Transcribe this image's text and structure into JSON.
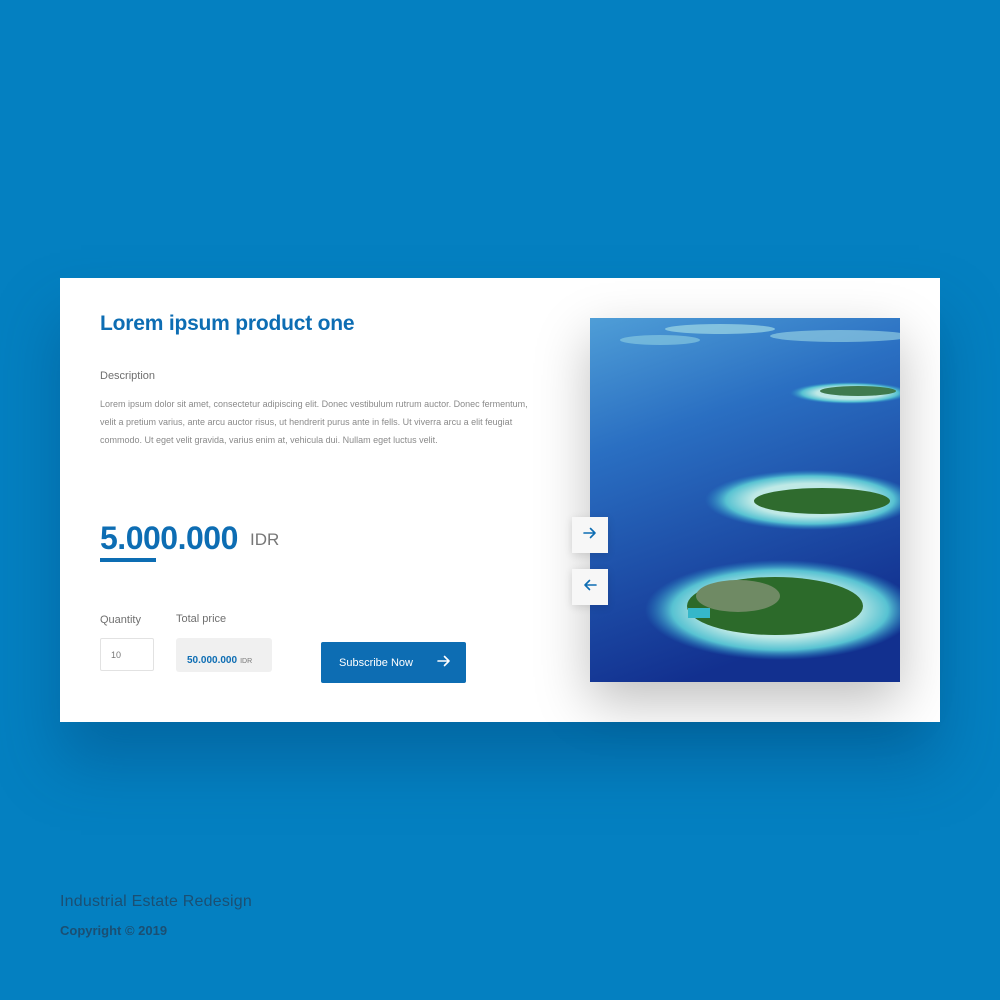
{
  "product": {
    "title": "Lorem ipsum product one",
    "description_label": "Description",
    "description": "Lorem ipsum dolor sit amet, consectetur adipiscing elit. Donec vestibulum rutrum auctor. Donec fermentum, velit a pretium varius, ante arcu auctor risus, ut hendrerit purus ante in fells. Ut viverra arcu a elit feugiat commodo. Ut eget velit gravida, varius enim at, vehicula dui. Nullam eget luctus velit.",
    "price": "5.000.000",
    "currency": "IDR"
  },
  "order": {
    "quantity_label": "Quantity",
    "quantity_value": "10",
    "total_label": "Total price",
    "total_value": "50.000.000",
    "total_currency": "IDR",
    "subscribe_label": "Subscribe Now"
  },
  "gallery": {
    "image_subject": "aerial view of tropical islands",
    "next_icon": "arrow-right-icon",
    "prev_icon": "arrow-left-icon"
  },
  "footer": {
    "title": "Industrial Estate Redesign",
    "copyright": "Copyright © 2019"
  },
  "colors": {
    "background": "#0480c1",
    "accent": "#0d6db3",
    "card": "#ffffff"
  }
}
